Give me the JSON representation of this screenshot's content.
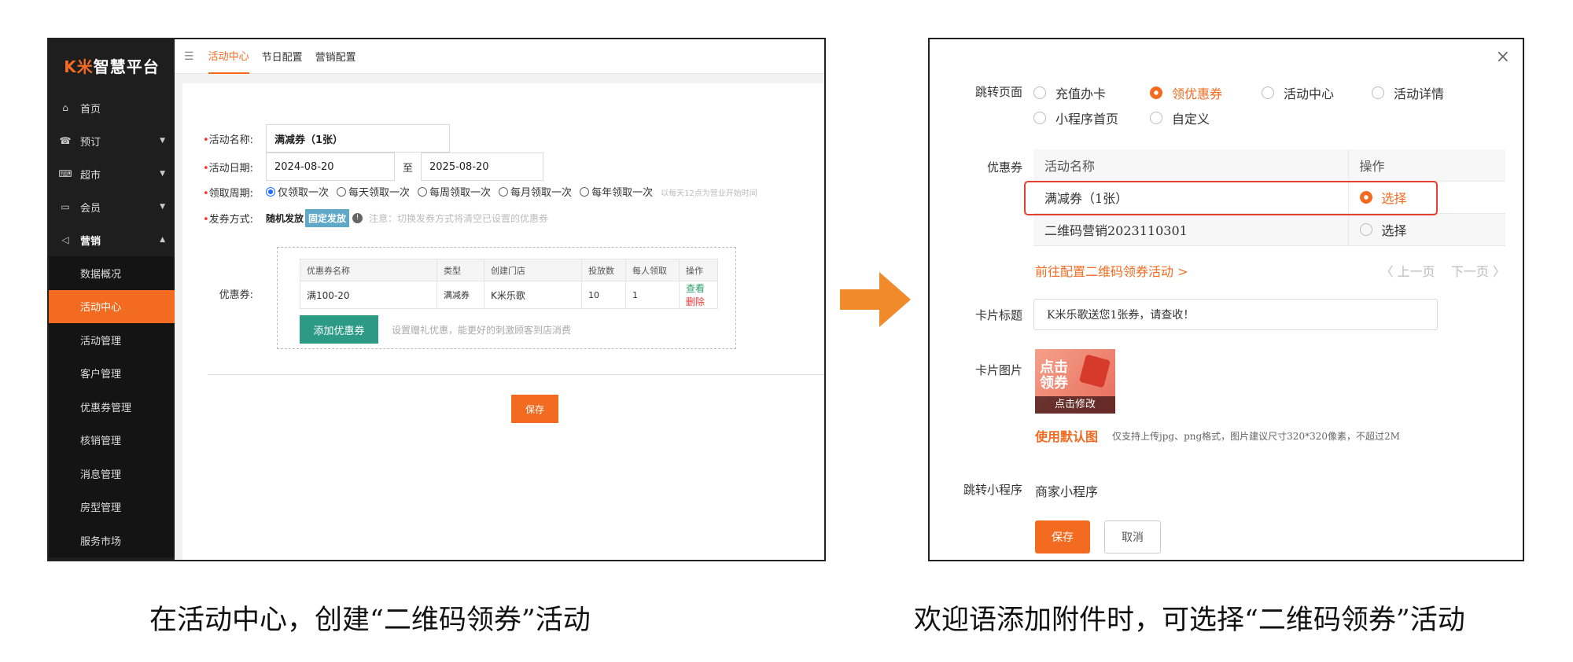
{
  "left": {
    "logo_k": "K米",
    "logo_text": "智慧平台",
    "nav": [
      {
        "label": "首页",
        "icon": "home-icon",
        "glyph": "⌂",
        "caret": ""
      },
      {
        "label": "预订",
        "icon": "booking-icon",
        "glyph": "☎",
        "caret": "▼"
      },
      {
        "label": "超市",
        "icon": "market-icon",
        "glyph": "⌨",
        "caret": "▼"
      },
      {
        "label": "会员",
        "icon": "member-card-icon",
        "glyph": "▭",
        "caret": "▼"
      },
      {
        "label": "营销",
        "icon": "megaphone-icon",
        "glyph": "◁",
        "caret": "▲"
      }
    ],
    "sub_nav": [
      "数据概况",
      "活动中心",
      "活动管理",
      "客户管理",
      "优惠券管理",
      "核销管理",
      "消息管理",
      "房型管理",
      "服务市场"
    ],
    "tabs": [
      "活动中心",
      "节日配置",
      "营销配置"
    ],
    "form": {
      "name_label": "活动名称:",
      "name_value": "满减券（1张）",
      "date_label": "活动日期:",
      "date_start": "2024-08-20",
      "date_to": "至",
      "date_end": "2025-08-20",
      "period_label": "领取周期:",
      "period_options": [
        "仅领取一次",
        "每天领取一次",
        "每周领取一次",
        "每月领取一次",
        "每年领取一次"
      ],
      "period_hint": "以每天12点为营业开始时间",
      "issue_label": "发券方式:",
      "issue_random": "随机发放",
      "issue_fixed": "固定发放",
      "issue_hint": "注意：切换发券方式将清空已设置的优惠券",
      "coupon_label": "优惠券:",
      "coupon_headers": [
        "优惠券名称",
        "类型",
        "创建门店",
        "投放数",
        "每人领取",
        "操作"
      ],
      "coupon_row": {
        "name": "满100-20",
        "type": "满减券",
        "store": "K米乐歌",
        "count": "10",
        "per": "1",
        "view": "查看",
        "del": "删除"
      },
      "add_button": "添加优惠券",
      "add_hint": "设置赠礼优惠，能更好的刺激顾客到店消费",
      "save": "保存"
    }
  },
  "right": {
    "close": "×",
    "jump_label": "跳转页面",
    "jump_options": [
      "充值办卡",
      "领优惠券",
      "活动中心",
      "活动详情",
      "小程序首页",
      "自定义"
    ],
    "coupon_label": "优惠券",
    "table_headers": [
      "活动名称",
      "操作"
    ],
    "rows": [
      {
        "name": "满减券（1张）",
        "action": "选择"
      },
      {
        "name": "二维码营销2023110301",
        "action": "选择"
      }
    ],
    "config_link": "前往配置二维码领券活动 >",
    "prev": "〈 上一页",
    "next": "下一页 〉",
    "card_title_label": "卡片标题",
    "card_title_value": "K米乐歌送您1张券，请查收！",
    "card_image_label": "卡片图片",
    "thumb_text_1": "点击",
    "thumb_text_2": "领券",
    "thumb_edit": "点击修改",
    "default_link": "使用默认图",
    "default_hint": "仅支持上传jpg、png格式，图片建议尺寸320*320像素，不超过2M",
    "mini_label": "跳转小程序",
    "mini_value": "商家小程序",
    "save": "保存",
    "cancel": "取消"
  },
  "captions": {
    "left": "在活动中心，创建“二维码领券”活动",
    "right": "欢迎语添加附件时，可选择“二维码领券”活动"
  },
  "colors": {
    "accent": "#f36b21",
    "sidebar": "#1e1e1e",
    "highlight": "#e53f2f",
    "teal": "#2d9a86"
  }
}
